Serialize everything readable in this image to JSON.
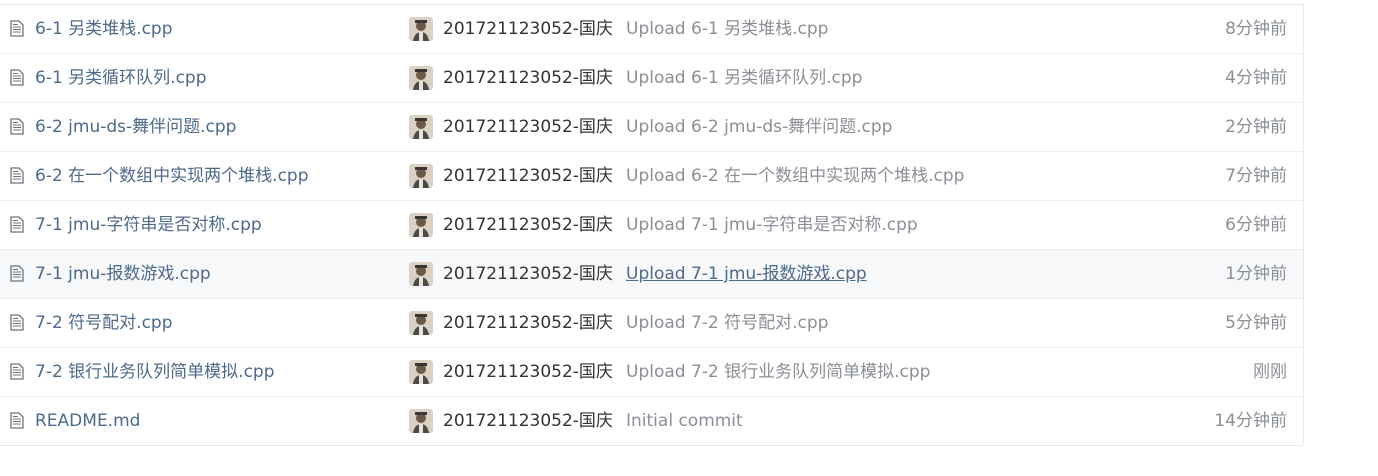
{
  "colors": {
    "file_link": "#4d6a8a",
    "muted_text": "#8a8f96",
    "author_text": "#333333",
    "highlight_row": "#f6f8fa"
  },
  "icons": {
    "file": "file-text-icon",
    "avatar": "user-avatar"
  },
  "files": [
    {
      "name": "6-1 另类堆栈.cpp",
      "author": "201721123052-国庆",
      "message": "Upload 6-1 另类堆栈.cpp",
      "time": "8分钟前"
    },
    {
      "name": "6-1 另类循环队列.cpp",
      "author": "201721123052-国庆",
      "message": "Upload 6-1 另类循环队列.cpp",
      "time": "4分钟前"
    },
    {
      "name": "6-2 jmu-ds-舞伴问题.cpp",
      "author": "201721123052-国庆",
      "message": "Upload 6-2 jmu-ds-舞伴问题.cpp",
      "time": "2分钟前"
    },
    {
      "name": "6-2 在一个数组中实现两个堆栈.cpp",
      "author": "201721123052-国庆",
      "message": "Upload 6-2 在一个数组中实现两个堆栈.cpp",
      "time": "7分钟前"
    },
    {
      "name": "7-1 jmu-字符串是否对称.cpp",
      "author": "201721123052-国庆",
      "message": "Upload 7-1 jmu-字符串是否对称.cpp",
      "time": "6分钟前"
    },
    {
      "name": "7-1 jmu-报数游戏.cpp",
      "author": "201721123052-国庆",
      "message": "Upload 7-1 jmu-报数游戏.cpp",
      "time": "1分钟前"
    },
    {
      "name": "7-2 符号配对.cpp",
      "author": "201721123052-国庆",
      "message": "Upload 7-2 符号配对.cpp",
      "time": "5分钟前"
    },
    {
      "name": "7-2 银行业务队列简单模拟.cpp",
      "author": "201721123052-国庆",
      "message": "Upload 7-2 银行业务队列简单模拟.cpp",
      "time": "刚刚"
    },
    {
      "name": "README.md",
      "author": "201721123052-国庆",
      "message": "Initial commit",
      "time": "14分钟前"
    }
  ]
}
